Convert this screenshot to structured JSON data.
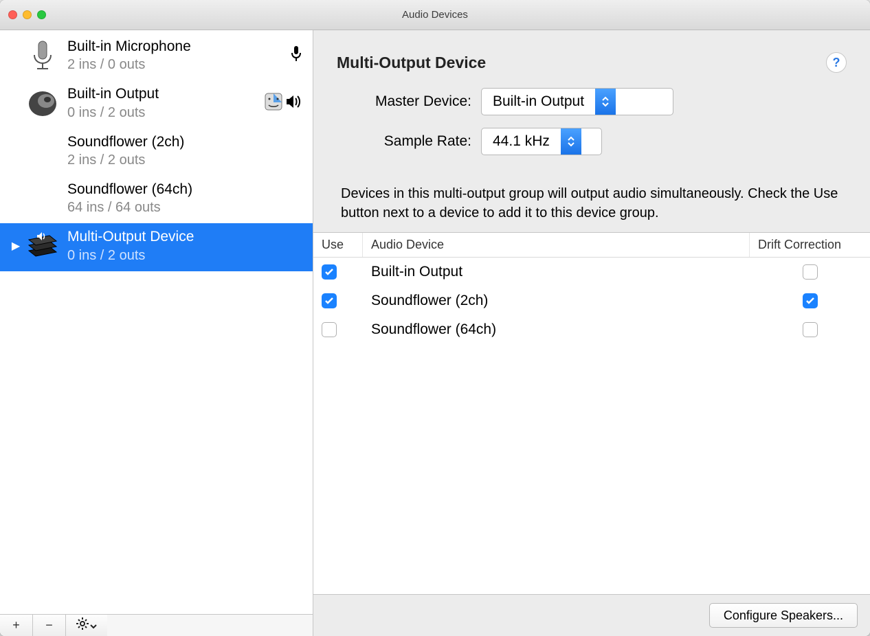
{
  "window": {
    "title": "Audio Devices"
  },
  "sidebar": {
    "devices": [
      {
        "name": "Built-in Microphone",
        "meta": "2 ins / 0 outs",
        "icon": "microphone",
        "badges": [
          "input-mic"
        ]
      },
      {
        "name": "Built-in Output",
        "meta": "0 ins / 2 outs",
        "icon": "speaker",
        "badges": [
          "finder",
          "output-speaker"
        ]
      },
      {
        "name": "Soundflower (2ch)",
        "meta": "2 ins / 2 outs",
        "icon": "none",
        "badges": []
      },
      {
        "name": "Soundflower (64ch)",
        "meta": "64 ins / 64 outs",
        "icon": "none",
        "badges": []
      },
      {
        "name": "Multi-Output Device",
        "meta": "0 ins / 2 outs",
        "icon": "stack-speaker",
        "badges": [],
        "selected": true
      }
    ],
    "footer": {
      "add": "+",
      "remove": "–",
      "settings": "gear"
    }
  },
  "main": {
    "title": "Multi-Output Device",
    "help": "?",
    "master_label": "Master Device:",
    "master_value": "Built-in Output",
    "sample_label": "Sample Rate:",
    "sample_value": "44.1 kHz",
    "description": "Devices in this multi-output group will output audio simultaneously. Check the Use button next to a device to add it to this device group.",
    "table": {
      "headers": {
        "use": "Use",
        "device": "Audio Device",
        "drift": "Drift Correction"
      },
      "rows": [
        {
          "use": true,
          "name": "Built-in Output",
          "drift": false
        },
        {
          "use": true,
          "name": "Soundflower (2ch)",
          "drift": true
        },
        {
          "use": false,
          "name": "Soundflower (64ch)",
          "drift": false
        }
      ]
    },
    "configure": "Configure Speakers..."
  }
}
